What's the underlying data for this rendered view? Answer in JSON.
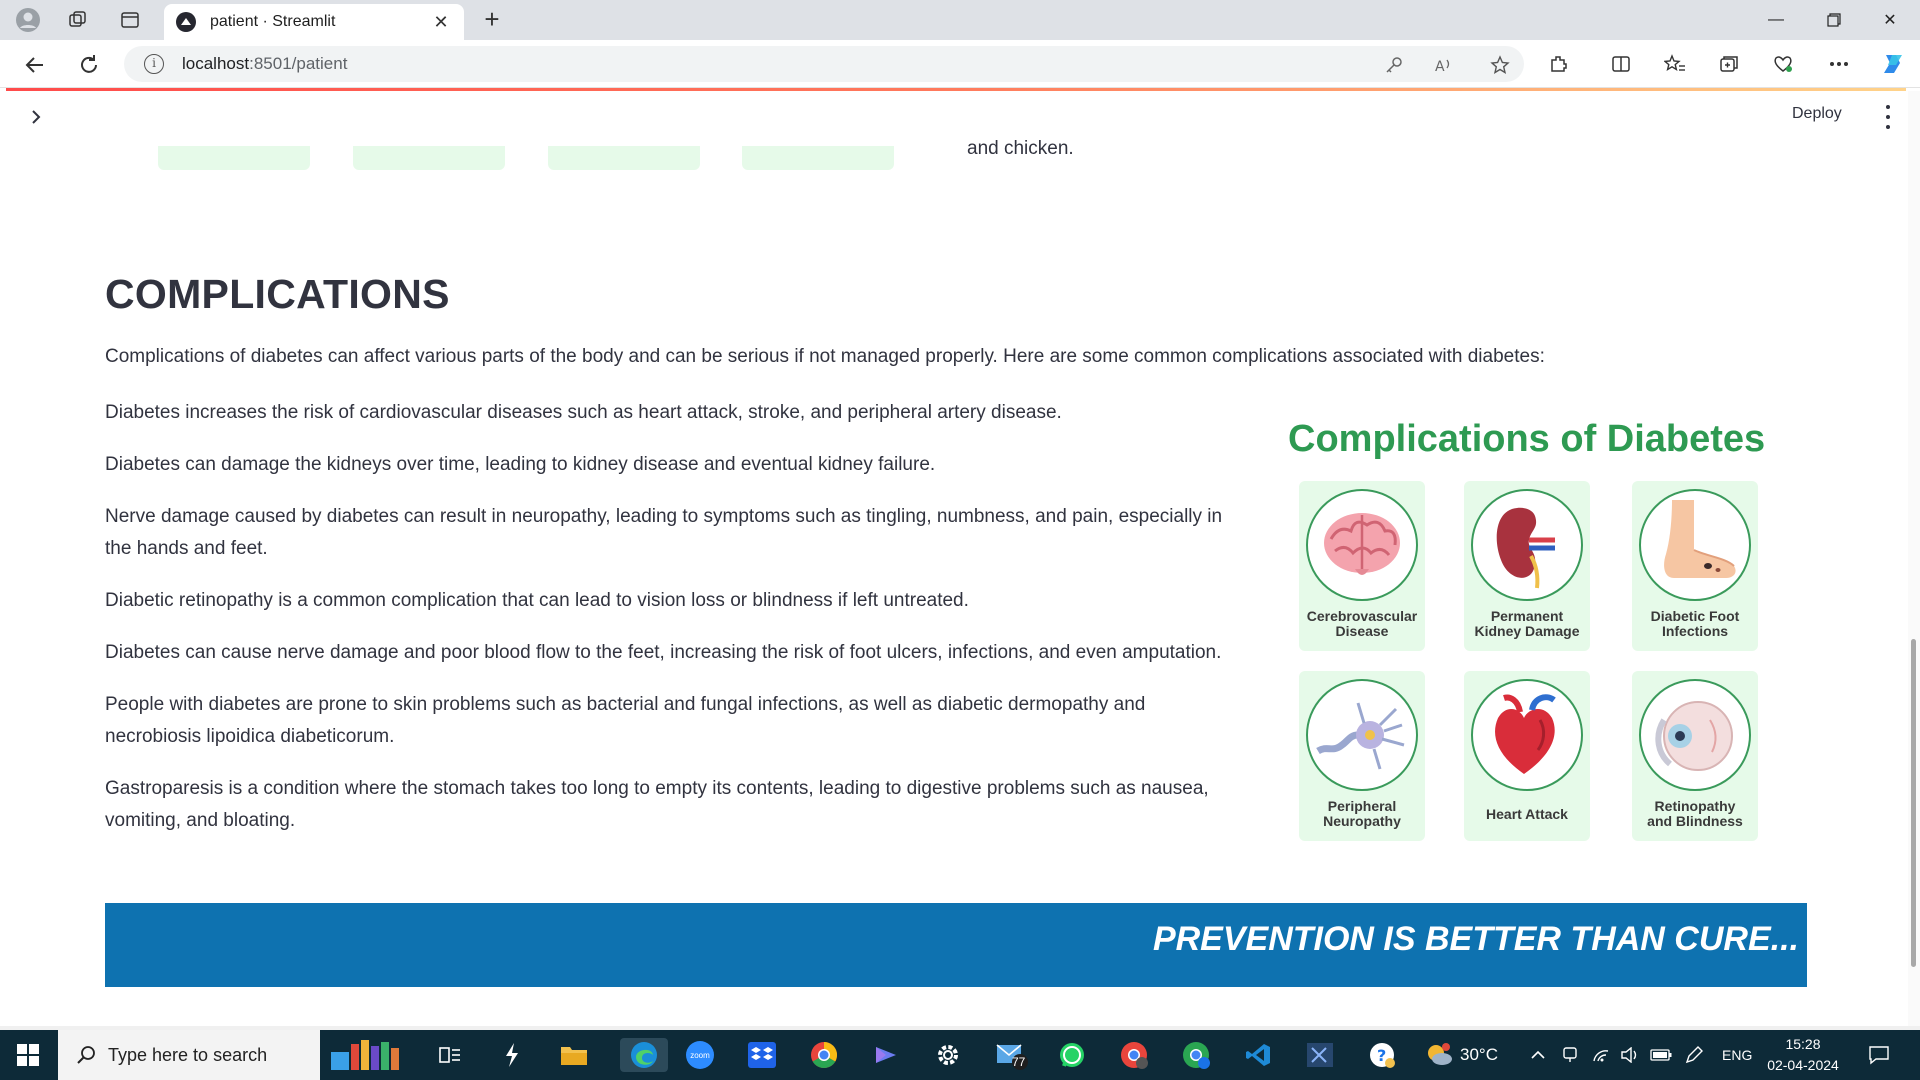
{
  "browser": {
    "tab_title": "patient · Streamlit",
    "url_host": "localhost",
    "url_rest": ":8501/patient"
  },
  "app": {
    "deploy_label": "Deploy",
    "prev_text": "and chicken.",
    "heading": "COMPLICATIONS",
    "intro": "Complications of diabetes can affect various parts of the body and can be serious if not managed properly. Here are some common complications associated with diabetes:",
    "paragraphs": [
      "Diabetes increases the risk of cardiovascular diseases such as heart attack, stroke, and peripheral artery disease.",
      "Diabetes can damage the kidneys over time, leading to kidney disease and eventual kidney failure.",
      "Nerve damage caused by diabetes can result in neuropathy, leading to symptoms such as tingling, numbness, and pain, especially in the hands and feet.",
      "Diabetic retinopathy is a common complication that can lead to vision loss or blindness if left untreated.",
      "Diabetes can cause nerve damage and poor blood flow to the feet, increasing the risk of foot ulcers, infections, and even amputation.",
      "People with diabetes are prone to skin problems such as bacterial and fungal infections, as well as diabetic dermopathy and necrobiosis lipoidica diabeticorum.",
      "Gastroparesis is a condition where the stomach takes too long to empty its contents, leading to digestive problems such as nausea, vomiting, and bloating."
    ],
    "infographic": {
      "title": "Complications of Diabetes",
      "tiles": [
        {
          "line1": "Cerebrovascular",
          "line2": "Disease",
          "icon": "brain-icon"
        },
        {
          "line1": "Permanent",
          "line2": "Kidney Damage",
          "icon": "kidney-icon"
        },
        {
          "line1": "Diabetic Foot",
          "line2": "Infections",
          "icon": "foot-icon"
        },
        {
          "line1": "Peripheral",
          "line2": "Neuropathy",
          "icon": "neuron-icon"
        },
        {
          "line1": "Heart Attack",
          "line2": "",
          "icon": "heart-icon"
        },
        {
          "line1": "Retinopathy",
          "line2": "and Blindness",
          "icon": "eye-icon"
        }
      ],
      "accent": "#2e9a52"
    },
    "banner": "PREVENTION IS BETTER THAN CURE..."
  },
  "taskbar": {
    "search_placeholder": "Type here to search",
    "mail_badge": "77",
    "weather": "30°C",
    "lang": "ENG",
    "time": "15:28",
    "date": "02-04-2024"
  }
}
